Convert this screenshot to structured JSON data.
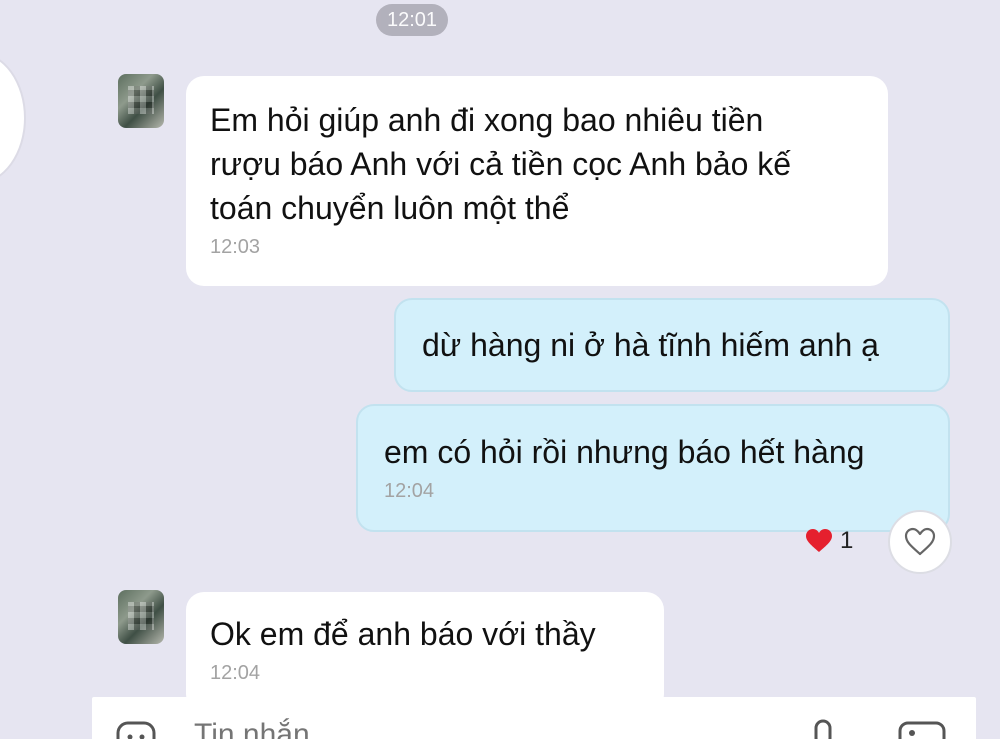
{
  "chat": {
    "time_divider": "12:01",
    "messages": [
      {
        "direction": "in",
        "text": "Em hỏi giúp anh đi xong bao nhiêu tiền\nrượu báo Anh với cả tiền cọc Anh bảo kế\ntoán chuyển luôn một thể",
        "time": "12:03"
      },
      {
        "direction": "out",
        "text": "dừ hàng ni ở hà tĩnh hiếm anh ạ",
        "time": ""
      },
      {
        "direction": "out",
        "text": "em có hỏi rồi nhưng báo hết hàng",
        "time": "12:04"
      },
      {
        "direction": "in",
        "text": "Ok em để anh báo với thầy",
        "time": "12:04"
      }
    ],
    "reaction": {
      "icon": "heart-icon",
      "count": "1",
      "color": "#e5202e"
    }
  },
  "input_bar": {
    "placeholder": "Tin nhắn",
    "icons": [
      "sticker-icon",
      "mic-icon",
      "image-icon"
    ]
  },
  "colors": {
    "background": "#e6e5f1",
    "incoming_bubble": "#ffffff",
    "outgoing_bubble": "#d3f0fb",
    "timestamp": "#a3a3a3"
  }
}
